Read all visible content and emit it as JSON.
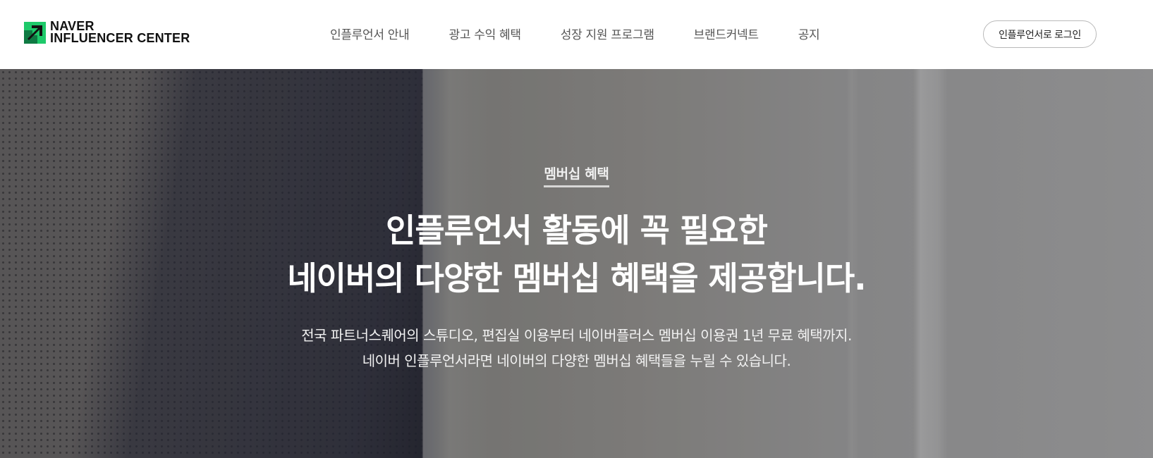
{
  "colors": {
    "brand_green": "#1ec96a",
    "header_bg": "#ffffff",
    "nav_text": "#555555",
    "hero_text": "#ffffff"
  },
  "header": {
    "logo": {
      "icon": "naver-arrow-logo-icon",
      "line1": "NAVER",
      "line2": "INFLUENCER CENTER"
    },
    "nav": [
      {
        "label": "인플루언서 안내"
      },
      {
        "label": "광고 수익 혜택"
      },
      {
        "label": "성장 지원 프로그램"
      },
      {
        "label": "브랜드커넥트"
      },
      {
        "label": "공지"
      }
    ],
    "login_label": "인플루언서로 로그인"
  },
  "hero": {
    "tag": "멤버십 혜택",
    "title_lines": [
      "인플루언서 활동에 꼭 필요한",
      "네이버의 다양한 멤버십 혜택을 제공합니다."
    ],
    "desc_lines": [
      "전국 파트너스퀘어의 스튜디오, 편집실 이용부터 네이버플러스 멤버십 이용권 1년 무료 혜택까지.",
      "네이버 인플루언서라면 네이버의 다양한 멤버십 혜택들을 누릴 수 있습니다."
    ]
  }
}
